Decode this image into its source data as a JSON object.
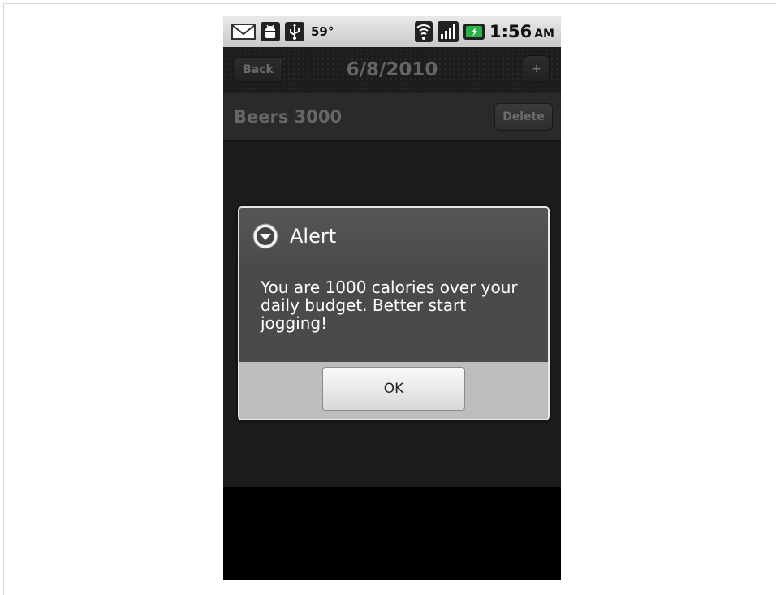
{
  "status_bar": {
    "icons_left": [
      "gmail-icon",
      "android-debug-icon",
      "usb-icon"
    ],
    "temperature": "59°",
    "icons_right": [
      "wifi-icon",
      "signal-icon",
      "battery-charging-icon"
    ],
    "time": "1:56",
    "ampm": "AM"
  },
  "title_bar": {
    "back_label": "Back",
    "title": "6/8/2010",
    "add_label": "+"
  },
  "section_bar": {
    "title": "Beers 3000",
    "delete_label": "Delete"
  },
  "dialog": {
    "title": "Alert",
    "icon": "alert-icon",
    "message": "You are 1000 calories over your daily budget. Better start jogging!",
    "ok_label": "OK"
  },
  "colors": {
    "title_text": "#666666",
    "dialog_bg": "#4a4a4a",
    "dialog_footer_bg": "#bdbdbd"
  }
}
